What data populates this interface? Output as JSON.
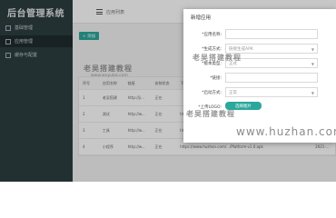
{
  "app": {
    "title": "后台管理系统"
  },
  "sidebar": {
    "items": [
      {
        "label": "基础管理"
      },
      {
        "label": "应用管理"
      },
      {
        "label": "缓存与配置"
      }
    ]
  },
  "topbar": {
    "breadcrumb": "应用列表"
  },
  "toolbar": {
    "add_label": "+ 添加"
  },
  "table": {
    "headers": [
      "序号",
      "应用名称",
      "链接",
      "安装状态",
      "下载地址",
      "时间"
    ],
    "rows": [
      [
        "1",
        "老吴搭建",
        "http://ji...",
        "正在",
        "",
        ""
      ],
      [
        "2",
        "测试",
        "http://w...",
        "正在",
        "https://www.huzhan...",
        "2021-..."
      ],
      [
        "3",
        "工具",
        "http://w...",
        "正在",
        "https://www.huzhan.com/.../Platform-v1.0.apk",
        "2021-..."
      ],
      [
        "4",
        "小程序",
        "http://w...",
        "正在",
        "https://www.huzhan.com/.../Platform-v1.0.apk",
        "2021-..."
      ]
    ]
  },
  "modal": {
    "title": "新增应用",
    "fields": [
      {
        "label": "*应用名称:",
        "value": ""
      },
      {
        "label": "*生成方式:",
        "value": "链接生成APK"
      },
      {
        "label": "*版本类型:",
        "value": "正式"
      },
      {
        "label": "*链接:",
        "value": ""
      },
      {
        "label": "*启动方式:",
        "value": "正常"
      }
    ],
    "upload": {
      "label": "*上传LOGO:",
      "button": "选择图片"
    }
  },
  "watermark": {
    "title": "老吴搭建教程",
    "subtitle": "www.wuyuba.com",
    "url": "www.huzhan.com"
  }
}
